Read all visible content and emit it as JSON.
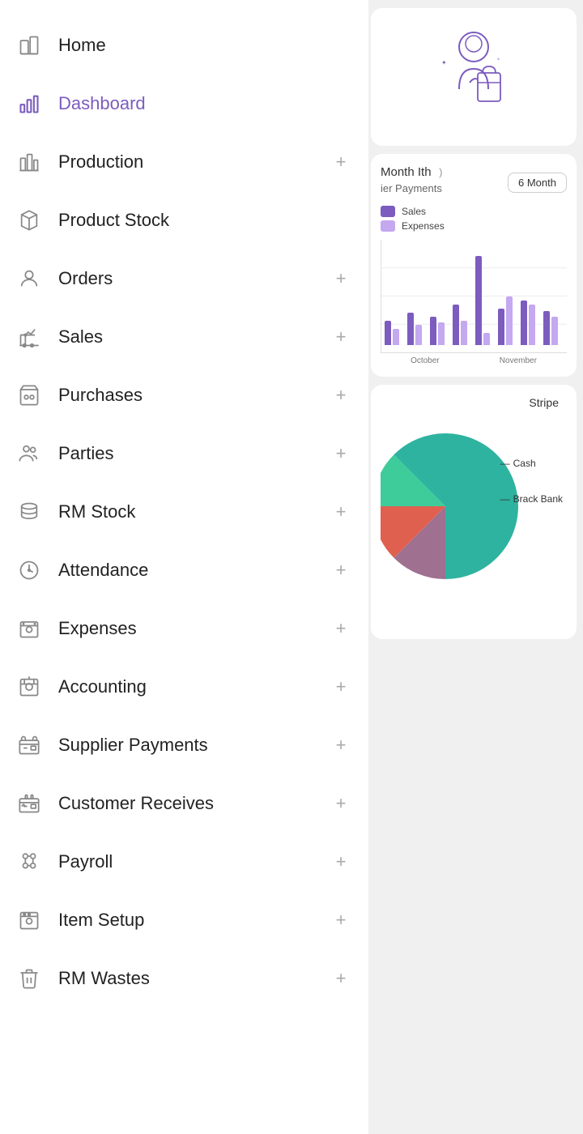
{
  "sidebar": {
    "items": [
      {
        "id": "home",
        "label": "Home",
        "icon": "home",
        "hasPlus": false,
        "active": false
      },
      {
        "id": "dashboard",
        "label": "Dashboard",
        "icon": "dashboard",
        "hasPlus": false,
        "active": true
      },
      {
        "id": "production",
        "label": "Production",
        "icon": "production",
        "hasPlus": true,
        "active": false
      },
      {
        "id": "product-stock",
        "label": "Product Stock",
        "icon": "product-stock",
        "hasPlus": false,
        "active": false
      },
      {
        "id": "orders",
        "label": "Orders",
        "icon": "orders",
        "hasPlus": true,
        "active": false
      },
      {
        "id": "sales",
        "label": "Sales",
        "icon": "sales",
        "hasPlus": true,
        "active": false
      },
      {
        "id": "purchases",
        "label": "Purchases",
        "icon": "purchases",
        "hasPlus": true,
        "active": false
      },
      {
        "id": "parties",
        "label": "Parties",
        "icon": "parties",
        "hasPlus": true,
        "active": false
      },
      {
        "id": "rm-stock",
        "label": "RM Stock",
        "icon": "rm-stock",
        "hasPlus": true,
        "active": false
      },
      {
        "id": "attendance",
        "label": "Attendance",
        "icon": "attendance",
        "hasPlus": true,
        "active": false
      },
      {
        "id": "expenses",
        "label": "Expenses",
        "icon": "expenses",
        "hasPlus": true,
        "active": false
      },
      {
        "id": "accounting",
        "label": "Accounting",
        "icon": "accounting",
        "hasPlus": true,
        "active": false
      },
      {
        "id": "supplier-payments",
        "label": "Supplier Payments",
        "icon": "supplier-payments",
        "hasPlus": true,
        "active": false
      },
      {
        "id": "customer-receives",
        "label": "Customer Receives",
        "icon": "customer-receives",
        "hasPlus": true,
        "active": false
      },
      {
        "id": "payroll",
        "label": "Payroll",
        "icon": "payroll",
        "hasPlus": true,
        "active": false
      },
      {
        "id": "item-setup",
        "label": "Item Setup",
        "icon": "item-setup",
        "hasPlus": true,
        "active": false
      },
      {
        "id": "rm-wastes",
        "label": "RM Wastes",
        "icon": "rm-wastes",
        "hasPlus": true,
        "active": false
      }
    ]
  },
  "right_panel": {
    "period_label": "6 Month",
    "month_label": "Month Ith",
    "chart_title": "ier Payments",
    "legend": {
      "sales_label": "Sales",
      "expenses_label": "Expenses"
    },
    "x_labels": [
      "October",
      "November"
    ],
    "bar_data": [
      {
        "sales": 30,
        "expenses": 20
      },
      {
        "sales": 40,
        "expenses": 25
      },
      {
        "sales": 35,
        "expenses": 28
      },
      {
        "sales": 50,
        "expenses": 30
      },
      {
        "sales": 110,
        "expenses": 15
      },
      {
        "sales": 45,
        "expenses": 60
      },
      {
        "sales": 55,
        "expenses": 50
      },
      {
        "sales": 42,
        "expenses": 35
      }
    ],
    "pie_stripe_label": "Stripe",
    "pie_cash_label": "Cash",
    "pie_brack_label": "Brack Bank"
  }
}
